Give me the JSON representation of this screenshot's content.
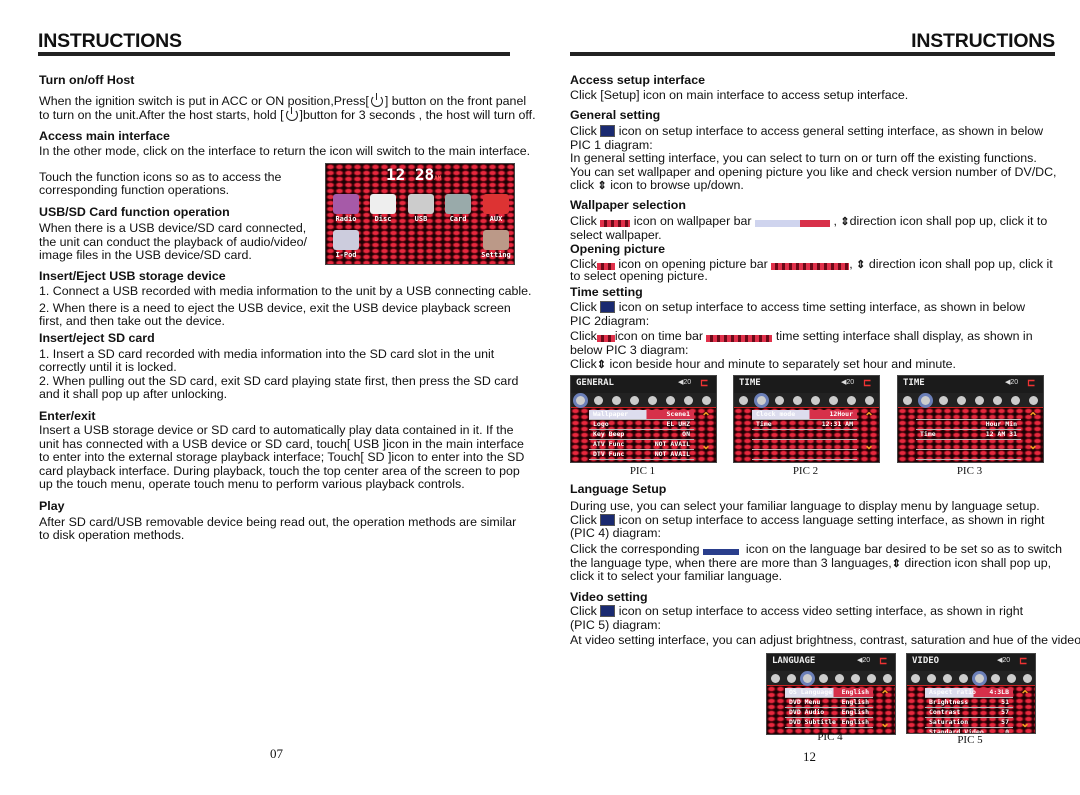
{
  "header": {
    "left_title": "INSTRUCTIONS",
    "right_title": "INSTRUCTIONS"
  },
  "left": {
    "turn_on": {
      "title": "Turn on/off Host",
      "l1a": "When the ignition switch is put in ACC or ON position,Press[",
      "l1b": "] button on the front panel",
      "l2a": "to turn on the unit.After the host starts, hold [",
      "l2b": "]button for 3 seconds , the host will turn off."
    },
    "access_main": {
      "title": "Access main interface",
      "l1": "In the other mode, click on the interface to return the icon will switch to the main interface."
    },
    "touch": {
      "l1": "Touch the function icons so as to access the",
      "l2": "corresponding function operations."
    },
    "usb_sd": {
      "title": "USB/SD Card function operation",
      "l1": "When there is a USB device/SD card connected,",
      "l2": "the unit can conduct the playback of audio/video/",
      "l3": "image files in the USB device/SD card."
    },
    "usb_eject": {
      "title": "Insert/Eject USB storage device",
      "p1": "1. Connect a USB recorded with media information to the unit by a USB connecting cable.",
      "p2l1": "2. When there is a need to eject the USB device, exit the USB device playback screen",
      "p2l2": "first, and then take out the device."
    },
    "sd_eject": {
      "title": "Insert/eject SD card",
      "p1l1": "1. Insert a SD card recorded with media information into the SD card slot in the unit",
      "p1l2": "correctly until it is locked.",
      "p2l1": "2. When pulling out the SD card, exit SD card playing state first, then press the SD card",
      "p2l2": "and it shall pop up after unlocking."
    },
    "enter_exit": {
      "title": "Enter/exit",
      "lines": [
        "Insert a USB storage device or SD card to automatically play data contained in it. If the",
        "unit has connected with a USB device or SD card, touch[ USB ]icon in the main interface",
        "to enter into the external storage playback interface; Touch[ SD ]icon to enter into the SD",
        "card playback interface. During playback, touch the top center area of the screen to pop",
        "up the touch menu, operate touch menu to perform various playback controls."
      ]
    },
    "play": {
      "title": "Play",
      "l1": "After SD card/USB removable device being read out, the operation methods are similar",
      "l2": "to disk operation methods."
    },
    "page_number": "07"
  },
  "main_screen": {
    "hour": "12",
    "minute": "28",
    "ampm": "AM",
    "items": [
      "Radio",
      "Disc",
      "USB",
      "Card",
      "AUX",
      "I-Pod",
      "Setting"
    ]
  },
  "right": {
    "setup": {
      "title": "Access setup interface",
      "l1": "Click [Setup] icon on main interface to access setup interface."
    },
    "general": {
      "title": "General setting",
      "l1a": "Click",
      "l1b": "icon on setup interface to access general setting interface, as shown in below",
      "l2": "PIC 1 diagram:",
      "l3": "In general setting interface, you can select to turn on or turn off the existing functions.",
      "l4": "You can set wallpaper and opening picture you like and check version number of DV/DC,",
      "l5a": "click",
      "l5b": "icon to browse up/down."
    },
    "wallpaper": {
      "title": "Wallpaper selection",
      "l1a": "Click",
      "l1b": "icon on wallpaper bar",
      "l1c": ",",
      "l1d": "direction icon shall pop up, click it to",
      "l2": "select wallpaper."
    },
    "opening": {
      "title": "Opening picture",
      "l1a": "Click",
      "l1b": "icon on opening picture bar",
      "l1c": ",",
      "l1d": "direction icon shall pop up, click it",
      "l2": "to select opening picture."
    },
    "time": {
      "title": "Time setting",
      "l1a": "Click",
      "l1b": "icon on setup interface to access time setting interface, as shown in below",
      "l2": "PIC 2diagram:",
      "l3a": "Click",
      "l3b": "icon on time bar",
      "l3c": "time setting interface shall display, as shown in",
      "l4": "below PIC 3 diagram:",
      "l5a": "Click",
      "l5b": "icon beside hour and minute to separately set hour and minute."
    },
    "language": {
      "title": "Language Setup",
      "l1": "During use, you can select your familiar language to display menu by language setup.",
      "l2a": "Click",
      "l2b": "icon on setup interface to access language setting interface, as shown in right",
      "l3": "(PIC 4) diagram:",
      "l4a": "Click the corresponding",
      "l4b": "icon on the language bar desired to be set so as to switch",
      "l5a": "the language type, when there are more than 3 languages,",
      "l5b": "direction icon shall pop up,",
      "l6": "click it to select your familiar language."
    },
    "video": {
      "title": "Video setting",
      "l1a": "Click",
      "l1b": "icon on setup interface to access video setting interface, as shown in right",
      "l2": "(PIC 5) diagram:",
      "l3": "At video setting interface, you can adjust brightness, contrast, saturation and hue of the video."
    },
    "page_number": "12"
  },
  "screens": [
    {
      "caption": "PIC 1",
      "title": "GENERAL",
      "volume": "20",
      "active_tab": 0,
      "rows": [
        [
          "Wallpaper",
          "Scene1"
        ],
        [
          "Logo",
          "EL UHZ"
        ],
        [
          "Key Beep",
          "ON"
        ],
        [
          "ATV Func",
          "NOT AVAIL"
        ],
        [
          "DTV Func",
          "NOT AVAIL"
        ]
      ]
    },
    {
      "caption": "PIC 2",
      "title": "TIME",
      "volume": "20",
      "active_tab": 1,
      "rows": [
        [
          "Clock mode",
          "12Hour"
        ],
        [
          "Time",
          "12:31 AM"
        ],
        [
          "",
          ""
        ],
        [
          "",
          ""
        ],
        [
          "",
          ""
        ]
      ]
    },
    {
      "caption": "PIC 3",
      "title": "TIME",
      "volume": "20",
      "active_tab": 1,
      "rows": [
        [
          "",
          ""
        ],
        [
          "",
          "Hour  Min"
        ],
        [
          "Time",
          "12 AM 31"
        ],
        [
          "",
          ""
        ],
        [
          "",
          ""
        ]
      ]
    },
    {
      "caption": "PIC 4",
      "title": "LANGUAGE",
      "volume": "20",
      "active_tab": 2,
      "rows": [
        [
          "OS Language",
          "English"
        ],
        [
          "DVD Menu",
          "English"
        ],
        [
          "DVD Audio",
          "English"
        ],
        [
          "DVD Subtitle",
          "English"
        ],
        [
          "",
          ""
        ]
      ]
    },
    {
      "caption": "PIC 5",
      "title": "VIDEO",
      "volume": "20",
      "active_tab": 4,
      "rows": [
        [
          "Aspect ratio",
          "4:3LB"
        ],
        [
          "Brightness",
          "51"
        ],
        [
          "Contrast",
          "57"
        ],
        [
          "Saturation",
          "57"
        ],
        [
          "Standard Video",
          "0"
        ]
      ]
    }
  ]
}
